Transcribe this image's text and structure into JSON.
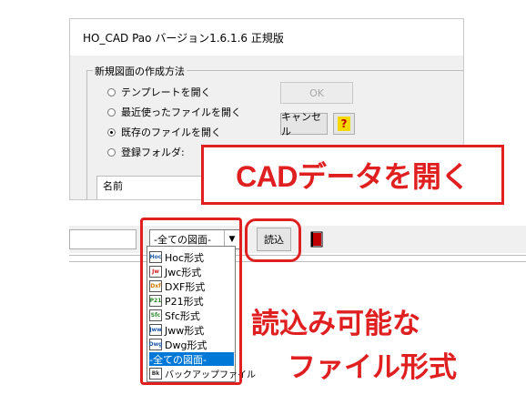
{
  "dialog": {
    "title": "HO_CAD Pao バージョン1.6.1.6 正規版",
    "group_label": "新規図面の作成方法",
    "options": [
      {
        "label": "テンプレートを開く",
        "selected": false
      },
      {
        "label": "最近使ったファイルを開く",
        "selected": false
      },
      {
        "label": "既存のファイルを開く",
        "selected": true
      },
      {
        "label": "登録フォルダ:",
        "selected": false
      }
    ],
    "ok_label": "OK",
    "cancel_label": "キャンセル",
    "help_label": "?",
    "list_header": "名前"
  },
  "callout": {
    "title": "CADデータを開く"
  },
  "toolbar": {
    "combo_value": "-全ての図面-",
    "read_label": "読込"
  },
  "dropdown": {
    "items": [
      {
        "label": "Hoc形式",
        "icon": "hoc-icon",
        "glyph": "Hoc",
        "color": "#1e5aa8",
        "selected": false
      },
      {
        "label": "Jwc形式",
        "icon": "jwc-icon",
        "glyph": "Jw",
        "color": "#cc2020",
        "selected": false
      },
      {
        "label": "DXF形式",
        "icon": "dxf-icon",
        "glyph": "Dxf",
        "color": "#d47a00",
        "selected": false
      },
      {
        "label": "P21形式",
        "icon": "p21-icon",
        "glyph": "P21",
        "color": "#2a8a2a",
        "selected": false
      },
      {
        "label": "Sfc形式",
        "icon": "sfc-icon",
        "glyph": "Sfc",
        "color": "#2a8a2a",
        "selected": false
      },
      {
        "label": "Jww形式",
        "icon": "jww-icon",
        "glyph": "Jww",
        "color": "#1e5aa8",
        "selected": false
      },
      {
        "label": "Dwg形式",
        "icon": "dwg-icon",
        "glyph": "Dwg",
        "color": "#1e5aa8",
        "selected": false
      },
      {
        "label": "-全ての図面-",
        "icon": "",
        "glyph": "",
        "color": "",
        "selected": true
      },
      {
        "label": "バックアップファイル",
        "icon": "backup-icon",
        "glyph": "Bk",
        "color": "#333333",
        "selected": false
      }
    ]
  },
  "annotation": {
    "line1": "読込み可能な",
    "line2": "ファイル形式"
  }
}
